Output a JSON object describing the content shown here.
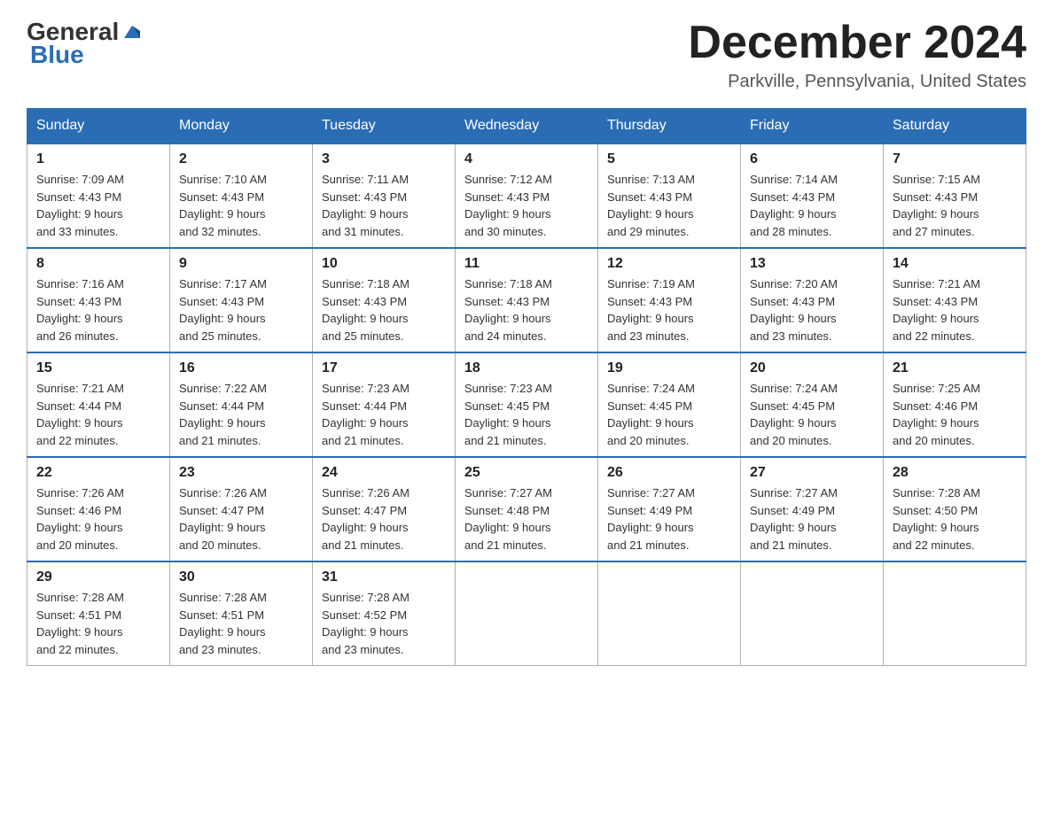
{
  "logo": {
    "general": "General",
    "blue": "Blue"
  },
  "header": {
    "month_year": "December 2024",
    "location": "Parkville, Pennsylvania, United States"
  },
  "days_of_week": [
    "Sunday",
    "Monday",
    "Tuesday",
    "Wednesday",
    "Thursday",
    "Friday",
    "Saturday"
  ],
  "weeks": [
    [
      {
        "day": "1",
        "sunrise": "7:09 AM",
        "sunset": "4:43 PM",
        "daylight": "9 hours and 33 minutes."
      },
      {
        "day": "2",
        "sunrise": "7:10 AM",
        "sunset": "4:43 PM",
        "daylight": "9 hours and 32 minutes."
      },
      {
        "day": "3",
        "sunrise": "7:11 AM",
        "sunset": "4:43 PM",
        "daylight": "9 hours and 31 minutes."
      },
      {
        "day": "4",
        "sunrise": "7:12 AM",
        "sunset": "4:43 PM",
        "daylight": "9 hours and 30 minutes."
      },
      {
        "day": "5",
        "sunrise": "7:13 AM",
        "sunset": "4:43 PM",
        "daylight": "9 hours and 29 minutes."
      },
      {
        "day": "6",
        "sunrise": "7:14 AM",
        "sunset": "4:43 PM",
        "daylight": "9 hours and 28 minutes."
      },
      {
        "day": "7",
        "sunrise": "7:15 AM",
        "sunset": "4:43 PM",
        "daylight": "9 hours and 27 minutes."
      }
    ],
    [
      {
        "day": "8",
        "sunrise": "7:16 AM",
        "sunset": "4:43 PM",
        "daylight": "9 hours and 26 minutes."
      },
      {
        "day": "9",
        "sunrise": "7:17 AM",
        "sunset": "4:43 PM",
        "daylight": "9 hours and 25 minutes."
      },
      {
        "day": "10",
        "sunrise": "7:18 AM",
        "sunset": "4:43 PM",
        "daylight": "9 hours and 25 minutes."
      },
      {
        "day": "11",
        "sunrise": "7:18 AM",
        "sunset": "4:43 PM",
        "daylight": "9 hours and 24 minutes."
      },
      {
        "day": "12",
        "sunrise": "7:19 AM",
        "sunset": "4:43 PM",
        "daylight": "9 hours and 23 minutes."
      },
      {
        "day": "13",
        "sunrise": "7:20 AM",
        "sunset": "4:43 PM",
        "daylight": "9 hours and 23 minutes."
      },
      {
        "day": "14",
        "sunrise": "7:21 AM",
        "sunset": "4:43 PM",
        "daylight": "9 hours and 22 minutes."
      }
    ],
    [
      {
        "day": "15",
        "sunrise": "7:21 AM",
        "sunset": "4:44 PM",
        "daylight": "9 hours and 22 minutes."
      },
      {
        "day": "16",
        "sunrise": "7:22 AM",
        "sunset": "4:44 PM",
        "daylight": "9 hours and 21 minutes."
      },
      {
        "day": "17",
        "sunrise": "7:23 AM",
        "sunset": "4:44 PM",
        "daylight": "9 hours and 21 minutes."
      },
      {
        "day": "18",
        "sunrise": "7:23 AM",
        "sunset": "4:45 PM",
        "daylight": "9 hours and 21 minutes."
      },
      {
        "day": "19",
        "sunrise": "7:24 AM",
        "sunset": "4:45 PM",
        "daylight": "9 hours and 20 minutes."
      },
      {
        "day": "20",
        "sunrise": "7:24 AM",
        "sunset": "4:45 PM",
        "daylight": "9 hours and 20 minutes."
      },
      {
        "day": "21",
        "sunrise": "7:25 AM",
        "sunset": "4:46 PM",
        "daylight": "9 hours and 20 minutes."
      }
    ],
    [
      {
        "day": "22",
        "sunrise": "7:26 AM",
        "sunset": "4:46 PM",
        "daylight": "9 hours and 20 minutes."
      },
      {
        "day": "23",
        "sunrise": "7:26 AM",
        "sunset": "4:47 PM",
        "daylight": "9 hours and 20 minutes."
      },
      {
        "day": "24",
        "sunrise": "7:26 AM",
        "sunset": "4:47 PM",
        "daylight": "9 hours and 21 minutes."
      },
      {
        "day": "25",
        "sunrise": "7:27 AM",
        "sunset": "4:48 PM",
        "daylight": "9 hours and 21 minutes."
      },
      {
        "day": "26",
        "sunrise": "7:27 AM",
        "sunset": "4:49 PM",
        "daylight": "9 hours and 21 minutes."
      },
      {
        "day": "27",
        "sunrise": "7:27 AM",
        "sunset": "4:49 PM",
        "daylight": "9 hours and 21 minutes."
      },
      {
        "day": "28",
        "sunrise": "7:28 AM",
        "sunset": "4:50 PM",
        "daylight": "9 hours and 22 minutes."
      }
    ],
    [
      {
        "day": "29",
        "sunrise": "7:28 AM",
        "sunset": "4:51 PM",
        "daylight": "9 hours and 22 minutes."
      },
      {
        "day": "30",
        "sunrise": "7:28 AM",
        "sunset": "4:51 PM",
        "daylight": "9 hours and 23 minutes."
      },
      {
        "day": "31",
        "sunrise": "7:28 AM",
        "sunset": "4:52 PM",
        "daylight": "9 hours and 23 minutes."
      },
      null,
      null,
      null,
      null
    ]
  ],
  "labels": {
    "sunrise": "Sunrise:",
    "sunset": "Sunset:",
    "daylight": "Daylight:"
  }
}
